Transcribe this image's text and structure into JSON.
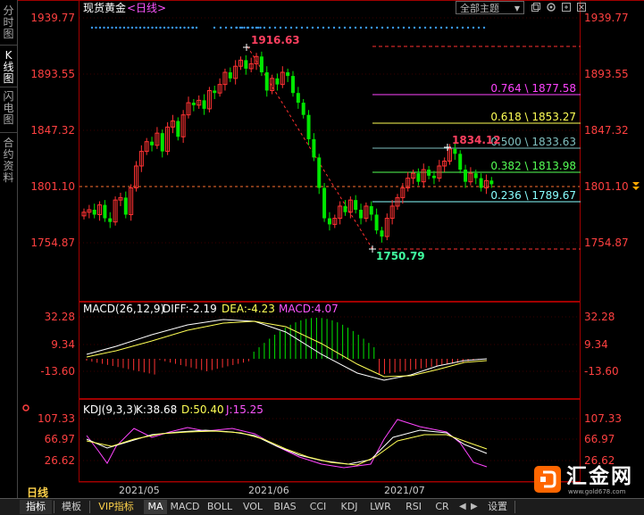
{
  "sidebar": {
    "tabs": [
      {
        "label": "分时图"
      },
      {
        "label": "K线图"
      },
      {
        "label": "闪电图"
      },
      {
        "label": "合约资料"
      }
    ]
  },
  "header": {
    "instrument": "现货黄金",
    "period": "<日线>",
    "theme_button": "全部主题",
    "theme_arrow": "▼"
  },
  "price_axis": {
    "ticks": [
      "1939.77",
      "1893.55",
      "1847.32",
      "1801.10",
      "1754.87"
    ],
    "current_price": "1801.10"
  },
  "annotations": {
    "high_label": "1916.63",
    "low_label": "1750.79",
    "swing_high_label": "1834.12"
  },
  "fibonacci": [
    {
      "label": "0.764 \\ 1877.58",
      "color": "#ff44ff"
    },
    {
      "label": "0.618 \\ 1853.27",
      "color": "#ffff55"
    },
    {
      "label": "0.500 \\ 1833.63",
      "color": "#80c0c0"
    },
    {
      "label": "0.382 \\ 1813.98",
      "color": "#55ff55"
    },
    {
      "label": "0.236 \\ 1789.67",
      "color": "#88ffff"
    }
  ],
  "macd": {
    "title": "MACD(26,12,9)",
    "diff": "DIFF:-2.19",
    "dea": "DEA:-4.23",
    "macd": "MACD:4.07",
    "ticks": [
      "32.28",
      "9.34",
      "-13.60"
    ]
  },
  "kdj": {
    "title": "KDJ(9,3,3)",
    "k": "K:38.68",
    "d": "D:50.40",
    "j": "J:15.25",
    "ticks": [
      "107.33",
      "66.97",
      "26.62"
    ]
  },
  "date_axis": {
    "period_label": "日线",
    "dates": [
      "2021/05",
      "2021/06",
      "2021/07"
    ]
  },
  "bottom_tabs": [
    "指标",
    "模板",
    "VIP指标",
    "MA",
    "MACD",
    "BOLL",
    "VOL",
    "BIAS",
    "CCI",
    "KDJ",
    "LWR",
    "RSI",
    "CR",
    "设置"
  ],
  "logo": {
    "text": "汇金网",
    "url": "www.gold678.com"
  },
  "colors": {
    "up": "#ff3232",
    "down": "#00e600",
    "grid": "#8b0000",
    "axis_text": "#ff4040"
  }
}
